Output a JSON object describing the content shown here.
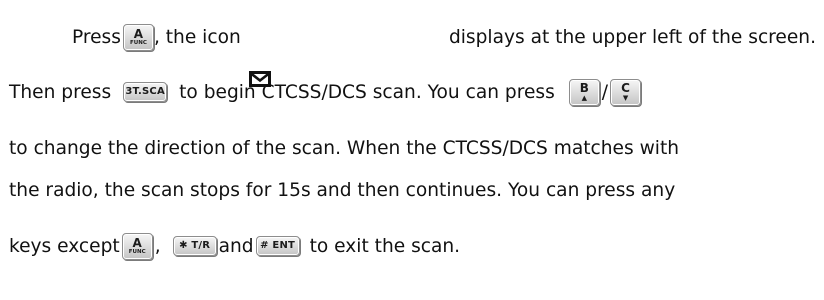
{
  "paragraph": {
    "line1": {
      "t1": "Press",
      "t2": ", the icon",
      "t3": "displays at the upper left of the screen."
    },
    "line2": {
      "t1": "Then press",
      "t2": "to begin CTCSS/DCS scan. You can press",
      "t3": "/"
    },
    "line3": "to change the direction of the scan. When the CTCSS/DCS matches with",
    "line4": "the radio, the scan stops for 15s and then continues. You can press any",
    "line5": {
      "t1": "keys except",
      "t2": ",",
      "t3": "and",
      "t4": "to exit the scan."
    }
  },
  "keys": {
    "a_func": {
      "big": "A",
      "small": "FUNC"
    },
    "three_tsca": {
      "label": "3T.SCA"
    },
    "b_up": {
      "big": "B",
      "arrow": "▲"
    },
    "c_down": {
      "big": "C",
      "arrow": "▼"
    },
    "star_tr": {
      "label": "✱ T/R"
    },
    "hash_ent": {
      "label": "# ENT"
    }
  },
  "icons": {
    "envelope": "envelope-icon"
  }
}
